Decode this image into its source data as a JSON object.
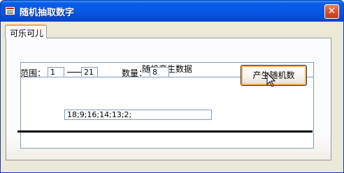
{
  "window": {
    "title": "随机抽取数字",
    "close_glyph": "✕"
  },
  "tabs": [
    {
      "label": "可乐可儿",
      "selected": true
    }
  ],
  "group": {
    "header": "随机产生数据"
  },
  "range": {
    "label": "范围：",
    "from_value": "1",
    "to_value": "21"
  },
  "count": {
    "label": "数量：",
    "value": "8"
  },
  "generate_button": {
    "label": "产生随机数"
  },
  "result": {
    "value": "18;9;16;14;13;2;"
  },
  "icons": {
    "window": "form-window-icon",
    "close": "close-icon",
    "cursor": "mouse-pointer-icon"
  },
  "colors": {
    "titlebar": "#0556e5",
    "tab_highlight": "#f9a732",
    "field_border": "#7f9db9",
    "button_focus": "#f3b352"
  }
}
